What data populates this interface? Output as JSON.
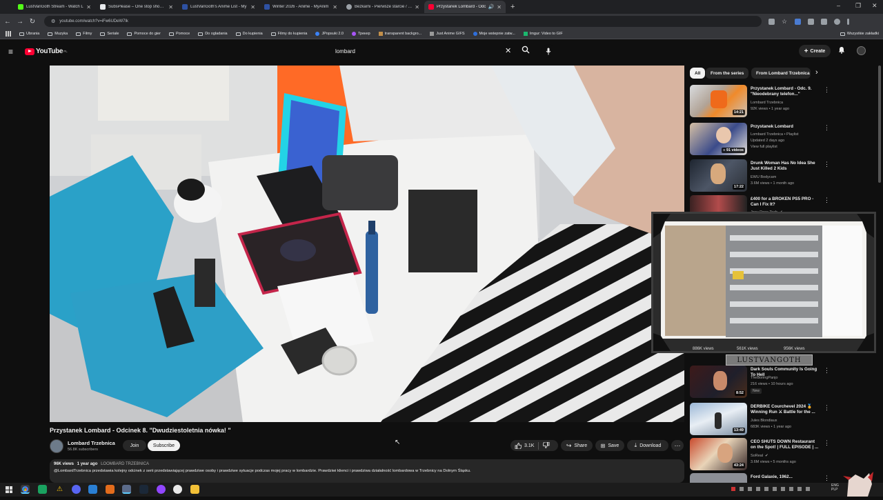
{
  "browser": {
    "tabs": [
      {
        "label": "LustVanGoth Stream - Watch L",
        "color": "#53fc18"
      },
      {
        "label": "SubsPlease – One stop shop fo",
        "color": "#e8eaed"
      },
      {
        "label": "LustVanGoth's Anime List - My",
        "color": "#2e51a2"
      },
      {
        "label": "Winter 2026 - Anime - MyAnim",
        "color": "#2e51a2"
      },
      {
        "label": "Bezkarni - Pierwsze starcie / Th",
        "color": "#9aa0a6"
      },
      {
        "label": "Przystanek Lombard - Odc",
        "color": "#ff0033"
      }
    ],
    "url": "youtube.com/watch?v=iFw6UDeW7lk",
    "bookmarks": [
      "Ubrania",
      "Muzyka",
      "Filmy",
      "Seriale",
      "Pomoce do gier",
      "Pomoce",
      "Do ogladania",
      "Do kupienia",
      "Filmy do kupienia",
      "JPopsuki 2.0",
      "Трекер",
      "transparent backgro...",
      "Just Anime GIFS",
      "Moje wstepnie zatw...",
      "Imgur: Video to GIF"
    ],
    "bookmarks_right": "Wszystkie zakładki"
  },
  "youtube": {
    "logo": "YouTube",
    "logo_region": "PL",
    "search_value": "lombard",
    "create_label": "Create"
  },
  "video": {
    "title": "Przystanek Lombard - Odcinek 8. \"Dwudziestoletnia nówka! \"",
    "channel": "Lombard Trzebnica",
    "subscribers": "56.8K subscribers",
    "join_label": "Join",
    "subscribe_label": "Subscribe",
    "likes": "3.1K",
    "share_label": "Share",
    "save_label": "Save",
    "download_label": "Download",
    "views": "96K views",
    "age": "1 year ago",
    "hashtag": "LOOMBARD TRZEBNICA",
    "description": "@LombardTrzebnica przedstawia kolejny odcinek z serii przedstawiającej prawdziwe osoby i prawdziwe sytuacje podczas mojej pracy w lombardzie. Prawdziwi klienci i prawdziwa działalność lombardowa w Trzebnicy na Dolnym Śląsku."
  },
  "sidebar": {
    "chips": [
      "All",
      "From the series",
      "From Lombard Trzebnica"
    ],
    "items": [
      {
        "title": "Przystanek Lombard - Odc. 9. \"Nieodebrany telefon...\"",
        "channel": "Lombard Trzebnica",
        "meta": "92K views • 1 year ago",
        "duration": "14:21"
      },
      {
        "title": "Przystanek Lombard",
        "channel": "Lombard Trzebnica • Playlist",
        "meta": "Updated 2 days ago",
        "meta2": "View full playlist",
        "duration": "91 videos"
      },
      {
        "title": "Drunk Woman Has No Idea She Just Killed 2 Kids",
        "channel": "EWU Bodycam",
        "meta": "3.6M views • 1 month ago",
        "duration": "17:22"
      },
      {
        "title": "£400 for a BROKEN PS5 PRO - Can I Fix It?",
        "channel": "Joey Does Tech",
        "meta": ""
      },
      {
        "title": "Dark Souls Community Is Going To Hell",
        "channel": "TheBoringPanjo",
        "meta": "216 views • 10 hours ago",
        "badge": "New",
        "duration": "8:52"
      },
      {
        "title": "DERBIKE Courchevel 2024 🏅 Winning Run ⚔ Battle for the ...",
        "channel": "Jules Blondiaux",
        "meta": "683K views • 1 year ago",
        "duration": "13:49"
      },
      {
        "title": "CEO SHUTS DOWN Restaurant on the Spot! | FULL EPISODE | ...",
        "channel": "SoReal",
        "meta": "3.6M views • 5 months ago",
        "duration": "43:24"
      },
      {
        "title": "Ford Galaxie, 1962...",
        "channel": "",
        "meta": ""
      }
    ],
    "overlay_views": [
      "886K views",
      "561K views",
      "956K views"
    ]
  },
  "overlay": {
    "name": "LUSTVANGOTH"
  },
  "taskbar": {
    "lang": "ENG",
    "lang2": "PLP"
  }
}
